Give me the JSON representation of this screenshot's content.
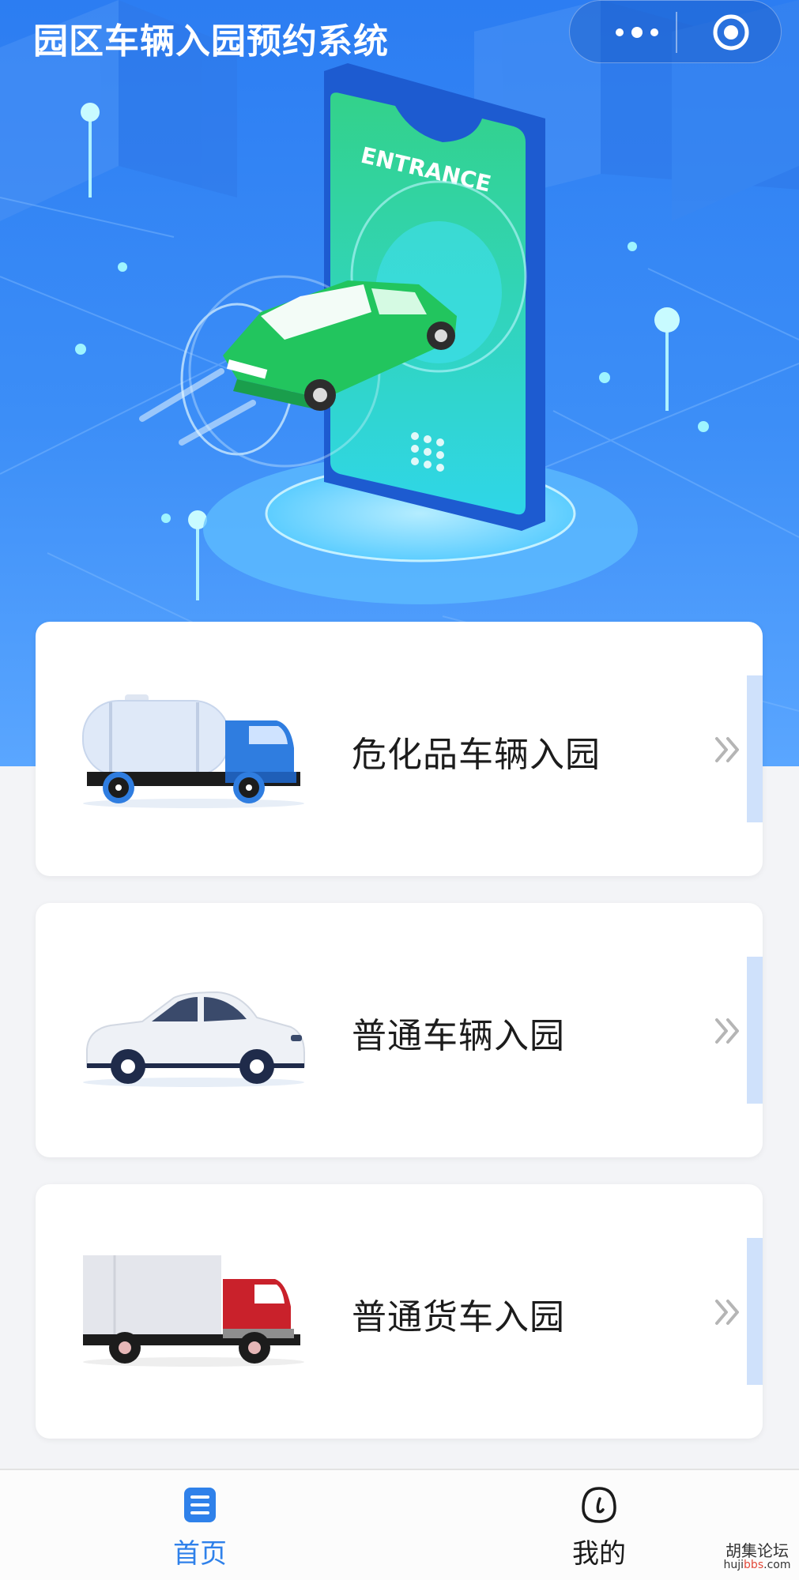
{
  "header": {
    "title": "园区车辆入园预约系统"
  },
  "hero": {
    "sign_text": "ENTRANCE"
  },
  "menu": [
    {
      "label": "危化品车辆入园",
      "vehicle": "tanker-truck-icon"
    },
    {
      "label": "普通车辆入园",
      "vehicle": "sedan-car-icon"
    },
    {
      "label": "普通货车入园",
      "vehicle": "cargo-truck-icon"
    }
  ],
  "tabbar": {
    "home_label": "首页",
    "mine_label": "我的"
  },
  "watermark": {
    "name": "胡集论坛",
    "url_prefix": "huji",
    "url_highlight": "bbs",
    "url_suffix": ".com"
  },
  "colors": {
    "hero_blue": "#2c7df2",
    "accent_blue": "#2f81ea",
    "card_bg": "#ffffff",
    "page_bg": "#f3f4f7",
    "accent_strip": "#cfe1fb"
  }
}
